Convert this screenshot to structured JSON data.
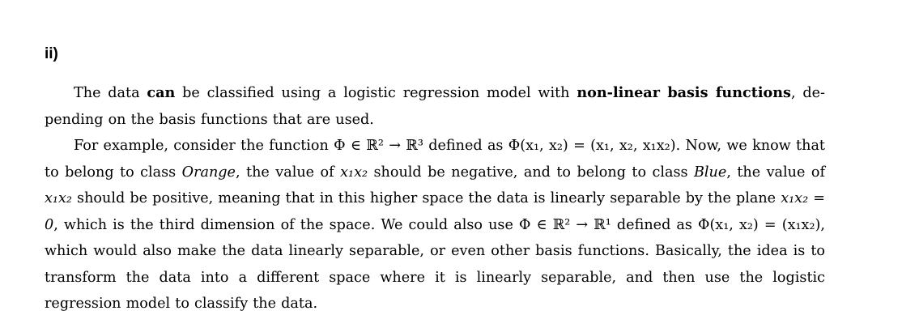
{
  "heading": "ii)",
  "p1": {
    "t1": "The data ",
    "b1": "can",
    "t2": " be classified using a logistic regression model with ",
    "b2": "non-linear basis functions",
    "t3": ", de-pending on the basis functions that are used."
  },
  "p2": {
    "t1": "For example, consider the function ",
    "m1": "Φ ∈ ℝ² → ℝ³",
    "t2": " defined as ",
    "m2": "Φ(x₁, x₂) = (x₁, x₂, x₁x₂)",
    "t3": ". Now, we know that to belong to class ",
    "i1": "Orange",
    "t4": ", the value of ",
    "m3": "x₁x₂",
    "t5": " should be negative, and to belong to class ",
    "i2": "Blue",
    "t6": ", the value of ",
    "m4": "x₁x₂",
    "t7": " should be positive, meaning that in this higher space the data is linearly separable by the plane ",
    "m5": "x₁x₂ = 0",
    "t8": ", which is the third dimension of the space. We could also use ",
    "m6": "Φ ∈ ℝ² → ℝ¹",
    "t9": " defined as ",
    "m7": "Φ(x₁, x₂) = (x₁x₂)",
    "t10": ", which would also make the data linearly separable, or even other basis functions. Basically, the idea is to transform the data into a different space where it is linearly separable, and then use the logistic regression model to classify the data."
  }
}
